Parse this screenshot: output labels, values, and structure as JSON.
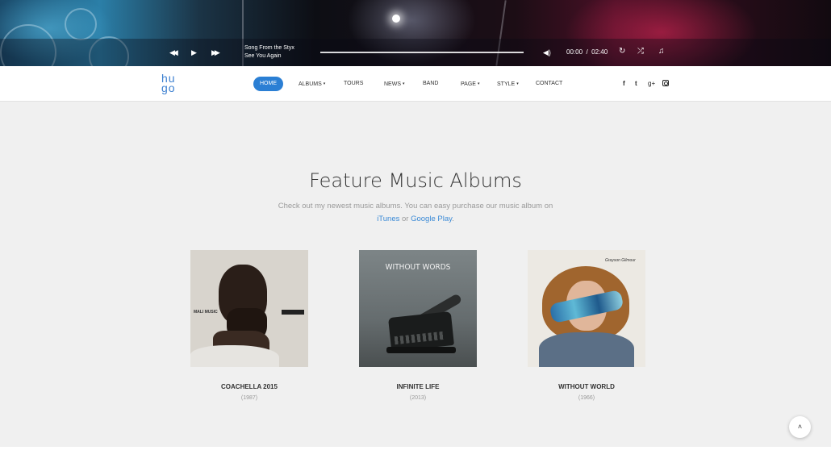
{
  "player": {
    "track_title": "Song From the Styx",
    "track_subtitle": "See You Again",
    "current_time": "00:00",
    "separator": "/",
    "duration": "02:40",
    "controls": {
      "prev": "◀◀",
      "play": "▶",
      "next": "▶▶",
      "volume": "◀)",
      "repeat": "↻",
      "shuffle": "⤮",
      "playlist": "♫"
    }
  },
  "logo": {
    "line1": "hu",
    "line2": "go"
  },
  "nav": {
    "home": "HOME",
    "albums": "ALBUMS",
    "tours": "TOURS",
    "news": "NEWS",
    "band": "BAND",
    "page": "PAGE",
    "style": "STYLE",
    "contact": "CONTACT",
    "caret": "▾"
  },
  "social": {
    "facebook": "f",
    "twitter": "t",
    "googleplus": "g+"
  },
  "section": {
    "title": "Feature Music Albums",
    "desc_before": "Check out my newest music albums. You can easy purchase our music album on",
    "link_itunes": "iTunes",
    "desc_or": " or ",
    "link_google_play": "Google Play",
    "desc_end": "."
  },
  "albums": [
    {
      "name": "COACHELLA 2015",
      "year": "(1987)",
      "cover_text_left": "MALI MUSIC"
    },
    {
      "name": "INFINITE LIFE",
      "year": "(2013)",
      "cover_text": "WITHOUT WORDS"
    },
    {
      "name": "WITHOUT WORLD",
      "year": "(1966)",
      "cover_text": "Grayson Gilmour"
    }
  ],
  "back_to_top": "˄"
}
